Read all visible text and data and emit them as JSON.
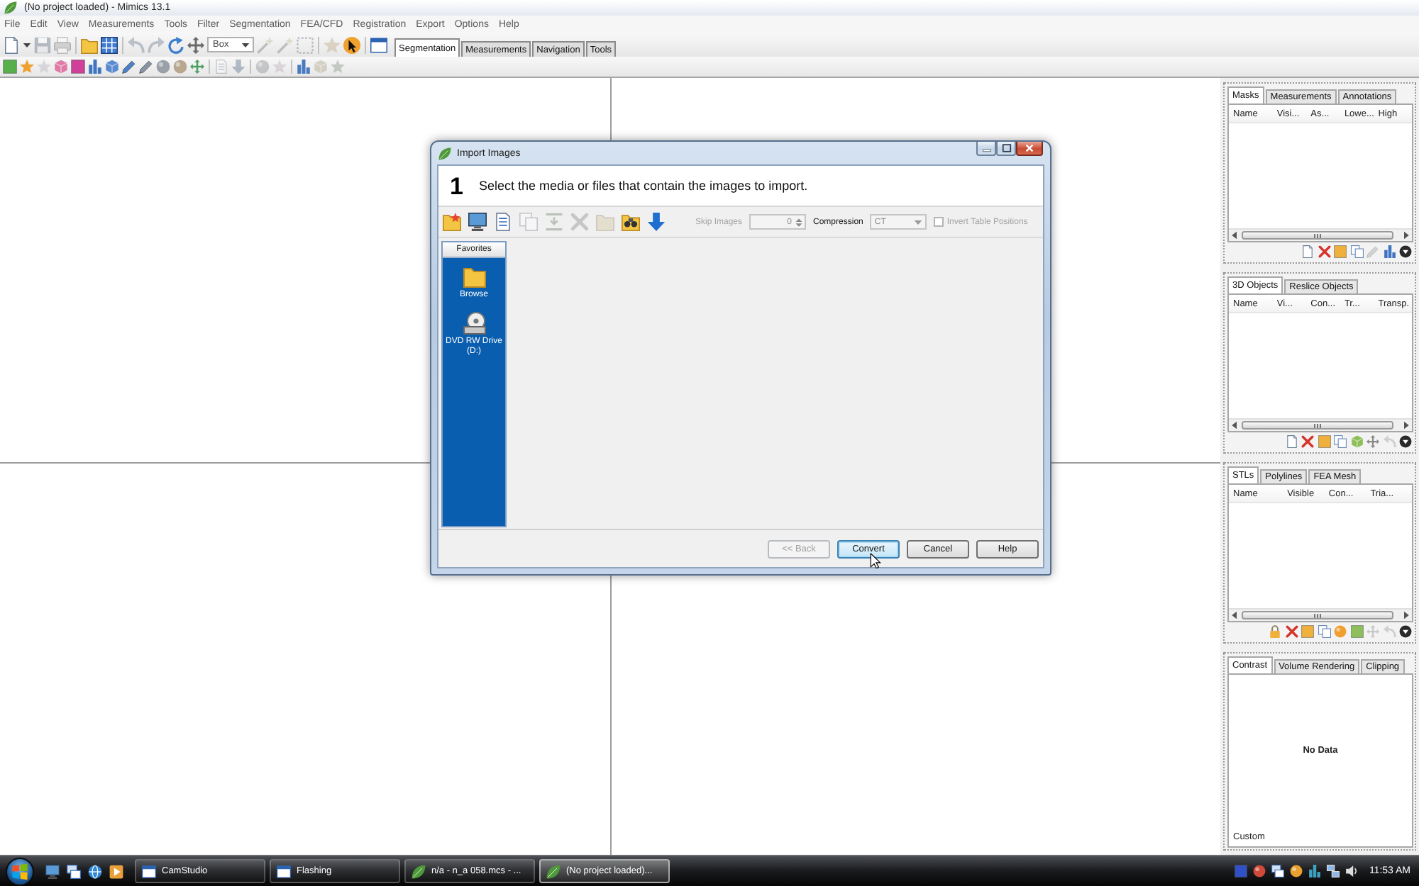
{
  "window": {
    "title": "(No project loaded) - Mimics 13.1"
  },
  "menu": [
    "File",
    "Edit",
    "View",
    "Measurements",
    "Tools",
    "Filter",
    "Segmentation",
    "FEA/CFD",
    "Registration",
    "Export",
    "Options",
    "Help"
  ],
  "toolbar": {
    "shape": "Box",
    "tabs": [
      {
        "label": "Segmentation",
        "selected": true
      },
      {
        "label": "Measurements",
        "selected": false
      },
      {
        "label": "Navigation",
        "selected": false
      },
      {
        "label": "Tools",
        "selected": false
      }
    ]
  },
  "panels": [
    {
      "kind": "table",
      "tabs": [
        {
          "label": "Masks",
          "selected": true
        },
        {
          "label": "Measurements",
          "selected": false
        },
        {
          "label": "Annotations",
          "selected": false
        }
      ],
      "columns": [
        "Name",
        "Visi...",
        "As...",
        "Lowe...",
        "High"
      ]
    },
    {
      "kind": "table",
      "tabs": [
        {
          "label": "3D Objects",
          "selected": true
        },
        {
          "label": "Reslice Objects",
          "selected": false
        }
      ],
      "columns": [
        "Name",
        "Vi...",
        "Con...",
        "Tr...",
        "Transp."
      ]
    },
    {
      "kind": "table",
      "tabs": [
        {
          "label": "STLs",
          "selected": true
        },
        {
          "label": "Polylines",
          "selected": false
        },
        {
          "label": "FEA Mesh",
          "selected": false
        }
      ],
      "columns": [
        "Name",
        "Visible",
        "Con...",
        "Tria..."
      ]
    },
    {
      "kind": "message",
      "tabs": [
        {
          "label": "Contrast",
          "selected": true
        },
        {
          "label": "Volume Rendering",
          "selected": false
        },
        {
          "label": "Clipping",
          "selected": false
        }
      ],
      "message": "No Data",
      "footer": "Custom"
    }
  ],
  "dialog": {
    "title": "Import Images",
    "step": "1",
    "instruction": "Select the media or files that contain the images to import.",
    "skip_images": {
      "label": "Skip Images",
      "value": "0",
      "disabled": true
    },
    "compression": {
      "label": "Compression",
      "value": "CT",
      "disabled": true
    },
    "invert": {
      "label": "Invert Table Positions",
      "checked": false,
      "disabled": true
    },
    "favorites": {
      "heading": "Favorites",
      "items": [
        {
          "kind": "folder",
          "label": "Browse"
        },
        {
          "kind": "drive",
          "label": "DVD RW Drive (D:)"
        }
      ]
    },
    "buttons": [
      {
        "label": "<< Back",
        "disabled": true,
        "default": false
      },
      {
        "label": "Convert",
        "disabled": false,
        "default": true
      },
      {
        "label": "Cancel",
        "disabled": false,
        "default": false
      },
      {
        "label": "Help",
        "disabled": false,
        "default": false
      }
    ]
  },
  "taskbar": {
    "tasks": [
      {
        "label": "CamStudio",
        "kind": "recorder",
        "selected": false
      },
      {
        "label": "Flashing",
        "kind": "recorder",
        "selected": false
      },
      {
        "label": "n/a - n_a 058.mcs - ...",
        "kind": "mimics",
        "selected": false
      },
      {
        "label": "(No project loaded)...",
        "kind": "mimics",
        "selected": true
      }
    ],
    "clock": "11:53 AM"
  }
}
